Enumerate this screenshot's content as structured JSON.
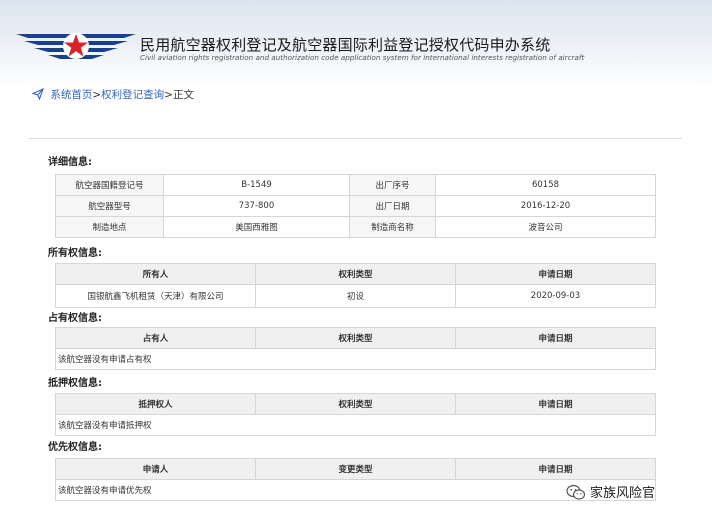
{
  "header": {
    "title_cn": "民用航空器权利登记及航空器国际利益登记授权代码申办系统",
    "title_en": "Civil aviation rights registration and authorization code application system for international interests registration of aircraft",
    "logo_icon": "caac-wings-star-logo",
    "colors": {
      "logo_blue": "#1b3f8f",
      "logo_red": "#d8232a"
    }
  },
  "breadcrumb": {
    "home": "系统首页",
    "sep1": ">",
    "query": "权利登记查询",
    "sep2": ">",
    "current": "正文",
    "link_color": "#3366bb"
  },
  "details": {
    "title": "详细信息:",
    "rows": [
      {
        "k1": "航空器国籍登记号",
        "v1": "B-1549",
        "k2": "出厂序号",
        "v2": "60158"
      },
      {
        "k1": "航空器型号",
        "v1": "737-800",
        "k2": "出厂日期",
        "v2": "2016-12-20"
      },
      {
        "k1": "制造地点",
        "v1": "美国西雅图",
        "k2": "制造商名称",
        "v2": "波音公司"
      }
    ]
  },
  "ownership": {
    "title": "所有权信息:",
    "headers": [
      "所有人",
      "权利类型",
      "申请日期"
    ],
    "rows": [
      [
        "国银航鑫飞机租赁（天津）有限公司",
        "初设",
        "2020-09-03"
      ]
    ]
  },
  "possession": {
    "title": "占有权信息:",
    "headers": [
      "占有人",
      "权利类型",
      "申请日期"
    ],
    "empty_text": "该航空器没有申请占有权"
  },
  "mortgage": {
    "title": "抵押权信息:",
    "headers": [
      "抵押权人",
      "权利类型",
      "申请日期"
    ],
    "empty_text": "该航空器没有申请抵押权"
  },
  "priority": {
    "title": "优先权信息:",
    "headers": [
      "申请人",
      "变更类型",
      "申请日期"
    ],
    "empty_text": "该航空器没有申请优先权"
  },
  "watermark": {
    "icon": "wechat-icon",
    "text": "家族风险官"
  }
}
